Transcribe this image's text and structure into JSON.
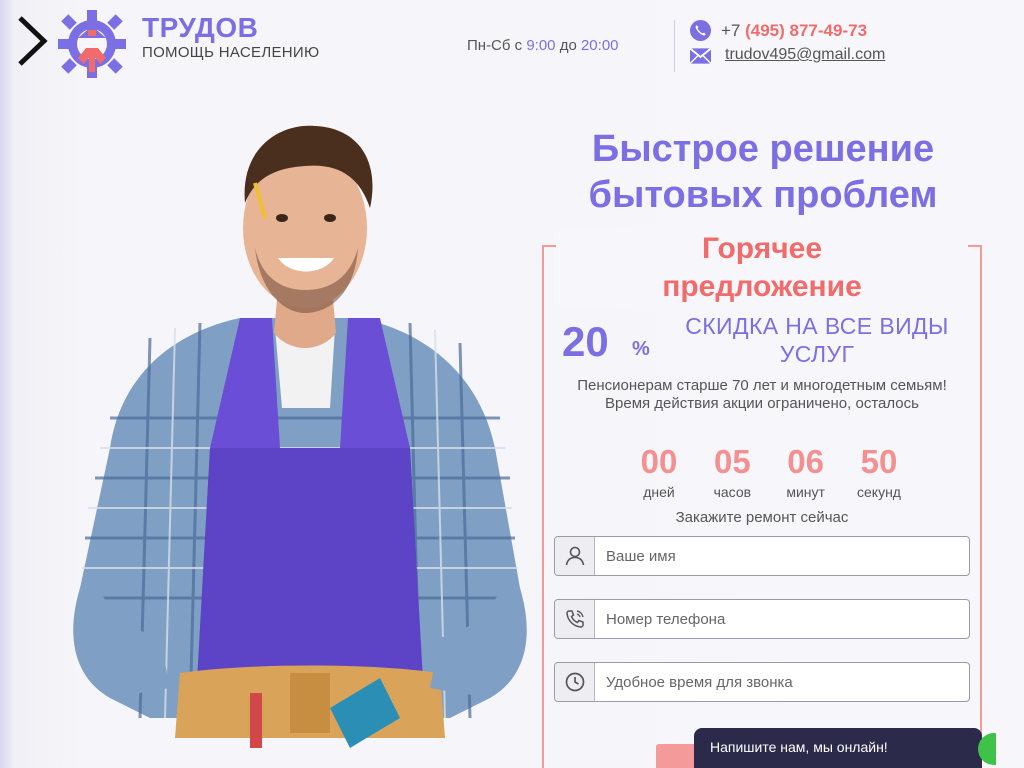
{
  "header": {
    "brand_title": "ТРУДОВ",
    "brand_subtitle": "ПОМОЩЬ НАСЕЛЕНИЮ",
    "hours_prefix": "Пн-Сб с ",
    "hours_from": "9:00",
    "hours_mid": " до ",
    "hours_to": "20:00",
    "phone_prefix": "+7 ",
    "phone_number": "(495) 877-49-73",
    "email": "trudov495@gmail.com"
  },
  "hero": {
    "headline_line1": "Быстрое решение",
    "headline_line2": "бытовых проблем"
  },
  "offer": {
    "title_line1": "Горячее",
    "title_line2": "предложение",
    "percent_value": "20",
    "percent_sign": "%",
    "discount_text": "СКИДКА НА ВСЕ ВИДЫ УСЛУГ",
    "description": "Пенсионерам старше 70 лет и многодетным семьям! Время действия акции ограничено, осталось",
    "timer": [
      {
        "value": "00",
        "label": "дней"
      },
      {
        "value": "05",
        "label": "часов"
      },
      {
        "value": "06",
        "label": "минут"
      },
      {
        "value": "50",
        "label": "секунд"
      }
    ],
    "cta_text": "Закажите ремонт сейчас"
  },
  "form": {
    "name_placeholder": "Ваше имя",
    "phone_placeholder": "Номер телефона",
    "time_placeholder": "Удобное время для звонка"
  },
  "chat": {
    "label": "Напишите нам, мы онлайн!"
  },
  "icons": [
    "chevron-right-icon",
    "gear-house-logo-icon",
    "phone-icon",
    "mail-icon",
    "user-icon",
    "phone-call-icon",
    "clock-icon"
  ],
  "colors": {
    "accent_purple": "#7b6fe3",
    "accent_coral": "#f26b6b",
    "timer_coral": "#f49090",
    "chat_bg": "#2c2a4a"
  }
}
